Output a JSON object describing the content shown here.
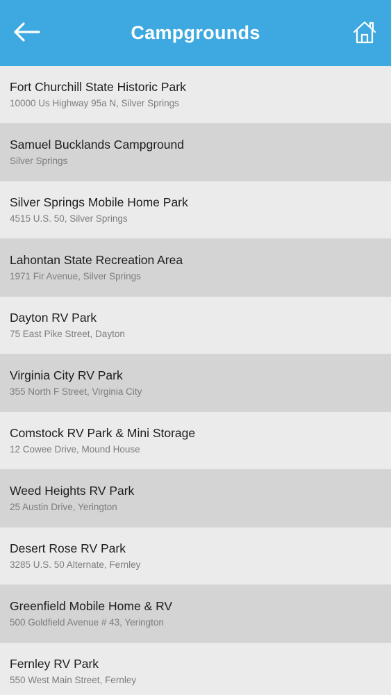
{
  "header": {
    "title": "Campgrounds",
    "back_icon": "back-arrow-icon",
    "home_icon": "home-icon",
    "background_color": "#3ea9e0"
  },
  "campgrounds": [
    {
      "name": "Fort Churchill State Historic Park",
      "address": "10000 Us Highway 95a N, Silver Springs"
    },
    {
      "name": "Samuel Bucklands Campground",
      "address": "Silver Springs"
    },
    {
      "name": "Silver Springs Mobile Home Park",
      "address": "4515 U.S. 50, Silver Springs"
    },
    {
      "name": "Lahontan State Recreation Area",
      "address": "1971 Fir Avenue, Silver Springs"
    },
    {
      "name": "Dayton RV Park",
      "address": "75 East Pike Street, Dayton"
    },
    {
      "name": "Virginia City RV Park",
      "address": "355 North F Street, Virginia City"
    },
    {
      "name": "Comstock RV Park & Mini Storage",
      "address": "12 Cowee Drive, Mound House"
    },
    {
      "name": "Weed Heights RV Park",
      "address": "25 Austin Drive, Yerington"
    },
    {
      "name": "Desert Rose RV Park",
      "address": "3285 U.S. 50 Alternate, Fernley"
    },
    {
      "name": "Greenfield Mobile Home & RV",
      "address": "500 Goldfield Avenue # 43, Yerington"
    },
    {
      "name": "Fernley RV Park",
      "address": "550 West Main Street, Fernley"
    }
  ]
}
